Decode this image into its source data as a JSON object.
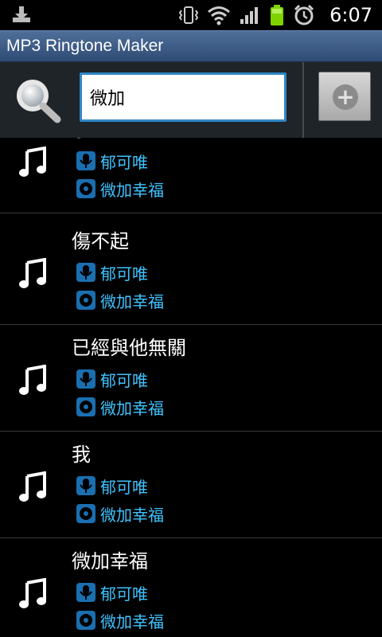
{
  "status_bar": {
    "time": "6:07",
    "icons": [
      "download-icon",
      "vibrate-icon",
      "wifi-icon",
      "signal-icon",
      "battery-icon",
      "alarm-icon"
    ]
  },
  "app": {
    "title": "MP3 Ringtone Maker"
  },
  "search": {
    "value": "微加",
    "icon": "search-icon",
    "add_button_icon": "add-icon"
  },
  "songs": [
    {
      "title": "小巷",
      "artist": "郁可唯",
      "album": "微加幸福"
    },
    {
      "title": "傷不起",
      "artist": "郁可唯",
      "album": "微加幸福"
    },
    {
      "title": "已經與他無關",
      "artist": "郁可唯",
      "album": "微加幸福"
    },
    {
      "title": "我",
      "artist": "郁可唯",
      "album": "微加幸福"
    },
    {
      "title": "微加幸福",
      "artist": "郁可唯",
      "album": "微加幸福"
    }
  ],
  "colors": {
    "title_bar": "#3d5d86",
    "search_area": "#1f2429",
    "search_border": "#2f87c8",
    "meta_text": "#3fc3ff",
    "meta_icon": "#1a6fb0"
  }
}
